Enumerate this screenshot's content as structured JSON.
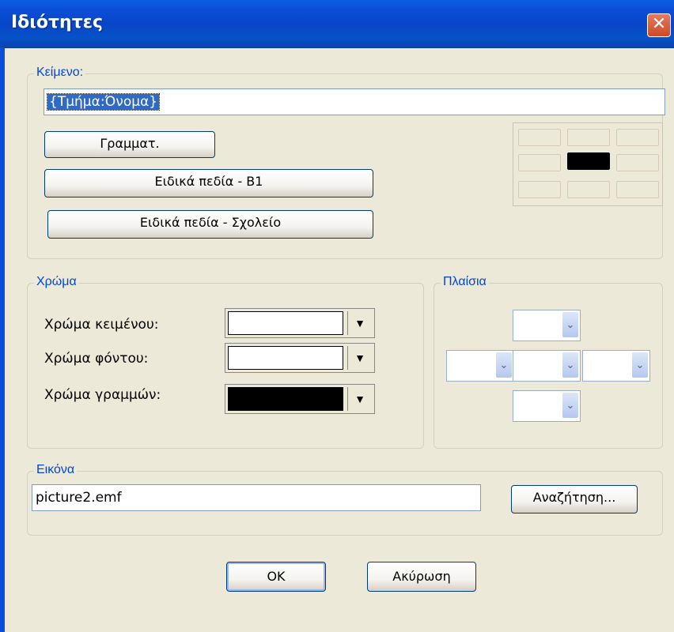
{
  "window": {
    "title": "Ιδιότητες",
    "close_glyph": "✕"
  },
  "text_group": {
    "legend": "Κείμενο:",
    "value": "{Τμήμα:Όνομα}",
    "font_button": "Γραμματ.",
    "special_b1_button": "Ειδικά πεδία - B1",
    "special_school_button": "Ειδικά πεδία - Σχολείο",
    "alignment": {
      "active_cell": "middle-center"
    }
  },
  "color_group": {
    "legend": "Χρώμα",
    "rows": [
      {
        "label": "Χρώμα κειμένου:",
        "color": "#ffffff"
      },
      {
        "label": "Χρώμα φόντου:",
        "color": "#ffffff"
      },
      {
        "label": "Χρώμα γραμμών:",
        "color": "#000000"
      }
    ],
    "arrow_glyph": "▼"
  },
  "borders_group": {
    "legend": "Πλαίσια",
    "arrow_glyph": "⌄"
  },
  "image_group": {
    "legend": "Εικόνα",
    "value": "picture2.emf",
    "browse_button": "Αναζήτηση..."
  },
  "footer": {
    "ok_label": "OK",
    "cancel_label": "Ακύρωση"
  }
}
